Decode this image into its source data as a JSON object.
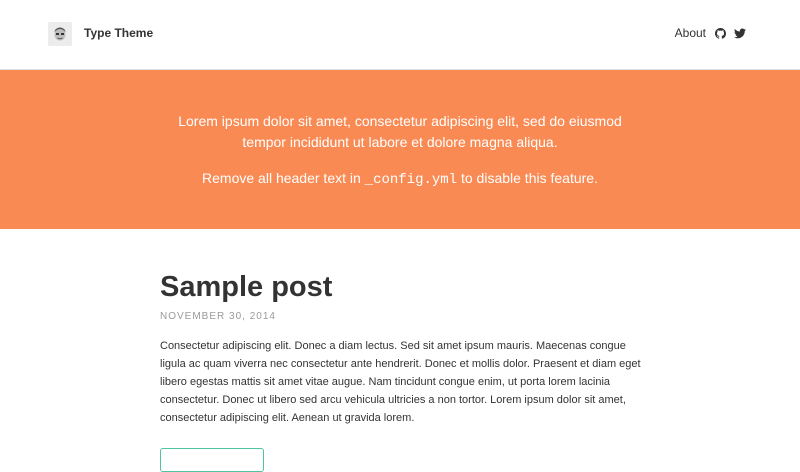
{
  "header": {
    "site_title": "Type Theme",
    "nav": {
      "about_label": "About",
      "github_icon": "github-icon",
      "twitter_icon": "twitter-icon"
    },
    "avatar_icon": "avatar-icon"
  },
  "hero": {
    "background_color": "#fa8a53",
    "line1": "Lorem ipsum dolor sit amet, consectetur adipiscing elit, sed do eiusmod tempor incididunt ut labore et dolore magna aliqua.",
    "line2_before": "Remove all header text in ",
    "line2_code": "_config.yml",
    "line2_after": " to disable this feature."
  },
  "post": {
    "title": "Sample post",
    "date": "NOVEMBER 30, 2014",
    "excerpt": "Consectetur adipiscing elit. Donec a diam lectus. Sed sit amet ipsum mauris. Maecenas congue ligula ac quam viverra nec consectetur ante hendrerit. Donec et mollis dolor. Praesent et diam eget libero egestas mattis sit amet vitae augue. Nam tincidunt congue enim, ut porta lorem lacinia consectetur. Donec ut libero sed arcu vehicula ultricies a non tortor. Lorem ipsum dolor sit amet, consectetur adipiscing elit. Aenean ut gravida lorem.",
    "button_accent": "#4fc3a1"
  }
}
